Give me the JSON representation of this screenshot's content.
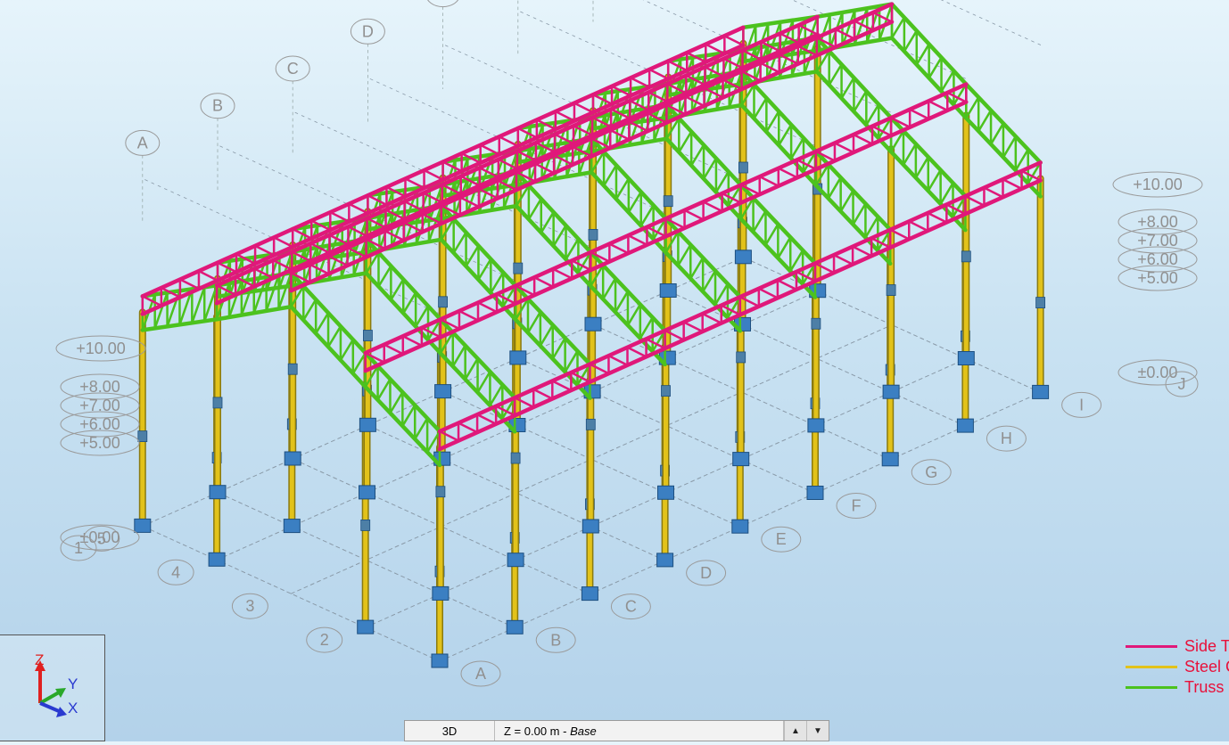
{
  "viewport": {
    "grid_labels_a": [
      "A",
      "B",
      "C",
      "D",
      "E",
      "F",
      "G",
      "H",
      "I"
    ],
    "grid_labels_b": [
      "1",
      "2",
      "3",
      "4",
      "5"
    ],
    "level_labels": [
      "+10.00",
      "+8.00",
      "+7.00",
      "+6.00",
      "+5.00",
      "±0.00"
    ],
    "far_grid_label": "J"
  },
  "legend": [
    {
      "label": "Side Truss",
      "color": "#e0187a"
    },
    {
      "label": "Steel Column",
      "color": "#e2c21a"
    },
    {
      "label": "Truss",
      "color": "#4cc21e"
    }
  ],
  "triad": {
    "z": "Z",
    "y": "Y",
    "x": "X"
  },
  "status_bar": {
    "view": "3D",
    "level_prefix": "Z = 0.00 m - ",
    "level_name": "Base",
    "up_arrow": "▲",
    "down_arrow": "▼"
  },
  "colors": {
    "side_truss": "#e0187a",
    "column": "#e2c21a",
    "truss": "#4cc21e",
    "base_plate": "#3b7fc2"
  }
}
